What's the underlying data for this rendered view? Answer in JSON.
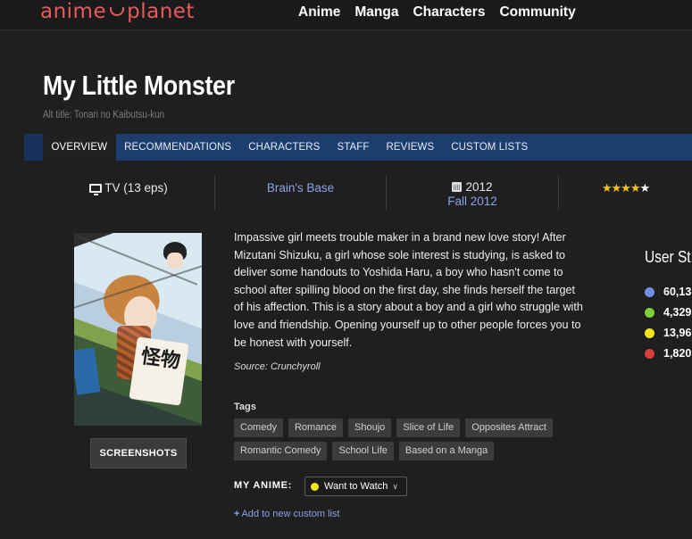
{
  "site": {
    "logo_left": "anime",
    "logo_right": "planet",
    "logo_color": "#e8585c",
    "nav": [
      "Anime",
      "Manga",
      "Characters",
      "Community"
    ]
  },
  "anime": {
    "title": "My Little Monster",
    "alt_title": "Alt title: Tonari no Kaibutsu-kun"
  },
  "subnav": {
    "items": [
      "OVERVIEW",
      "RECOMMENDATIONS",
      "CHARACTERS",
      "STAFF",
      "REVIEWS",
      "CUSTOM LISTS"
    ],
    "active": "OVERVIEW",
    "color": "#1c3d6e"
  },
  "info": {
    "type": "TV (13 eps)",
    "type_icon": "tv-icon",
    "studio": "Brain's Base",
    "year": "2012",
    "year_icon": "calendar-icon",
    "season": "Fall 2012",
    "rating_stars": 4.5,
    "stars_text": "★★★★",
    "half_star_text": "★"
  },
  "cover": {
    "jp_text": "怪物"
  },
  "screenshots_label": "SCREENSHOTS",
  "synopsis": "Impassive girl meets trouble maker in a brand new love story! After Mizutani Shizuku, a girl whose sole interest is studying, is asked to deliver some handouts to Yoshida Haru, a boy who hasn't come to school after spilling blood on the first day, she finds herself the target of his affection. This is a story about a boy and a girl who struggle with love and friendship. Opening yourself up to other people forces you to be honest with yourself.",
  "source": "Source: Crunchyroll",
  "tags": {
    "heading": "Tags",
    "row1": [
      "Comedy",
      "Romance",
      "Shoujo",
      "Slice of Life",
      "Opposites Attract"
    ],
    "row2": [
      "Romantic Comedy",
      "School Life",
      "Based on a Manga"
    ]
  },
  "my_anime": {
    "label": "MY ANIME:",
    "status": "Want to Watch",
    "status_color": "#f2e51b",
    "add_list": "Add to new custom list"
  },
  "user_stats": {
    "heading": "User St",
    "rows": [
      {
        "value": "60,13",
        "color": "#6f8fe0"
      },
      {
        "value": "4,329",
        "color": "#7cd13a"
      },
      {
        "value": "13,96",
        "color": "#f2e51b"
      },
      {
        "value": "1,820",
        "color": "#d9403a"
      }
    ]
  }
}
